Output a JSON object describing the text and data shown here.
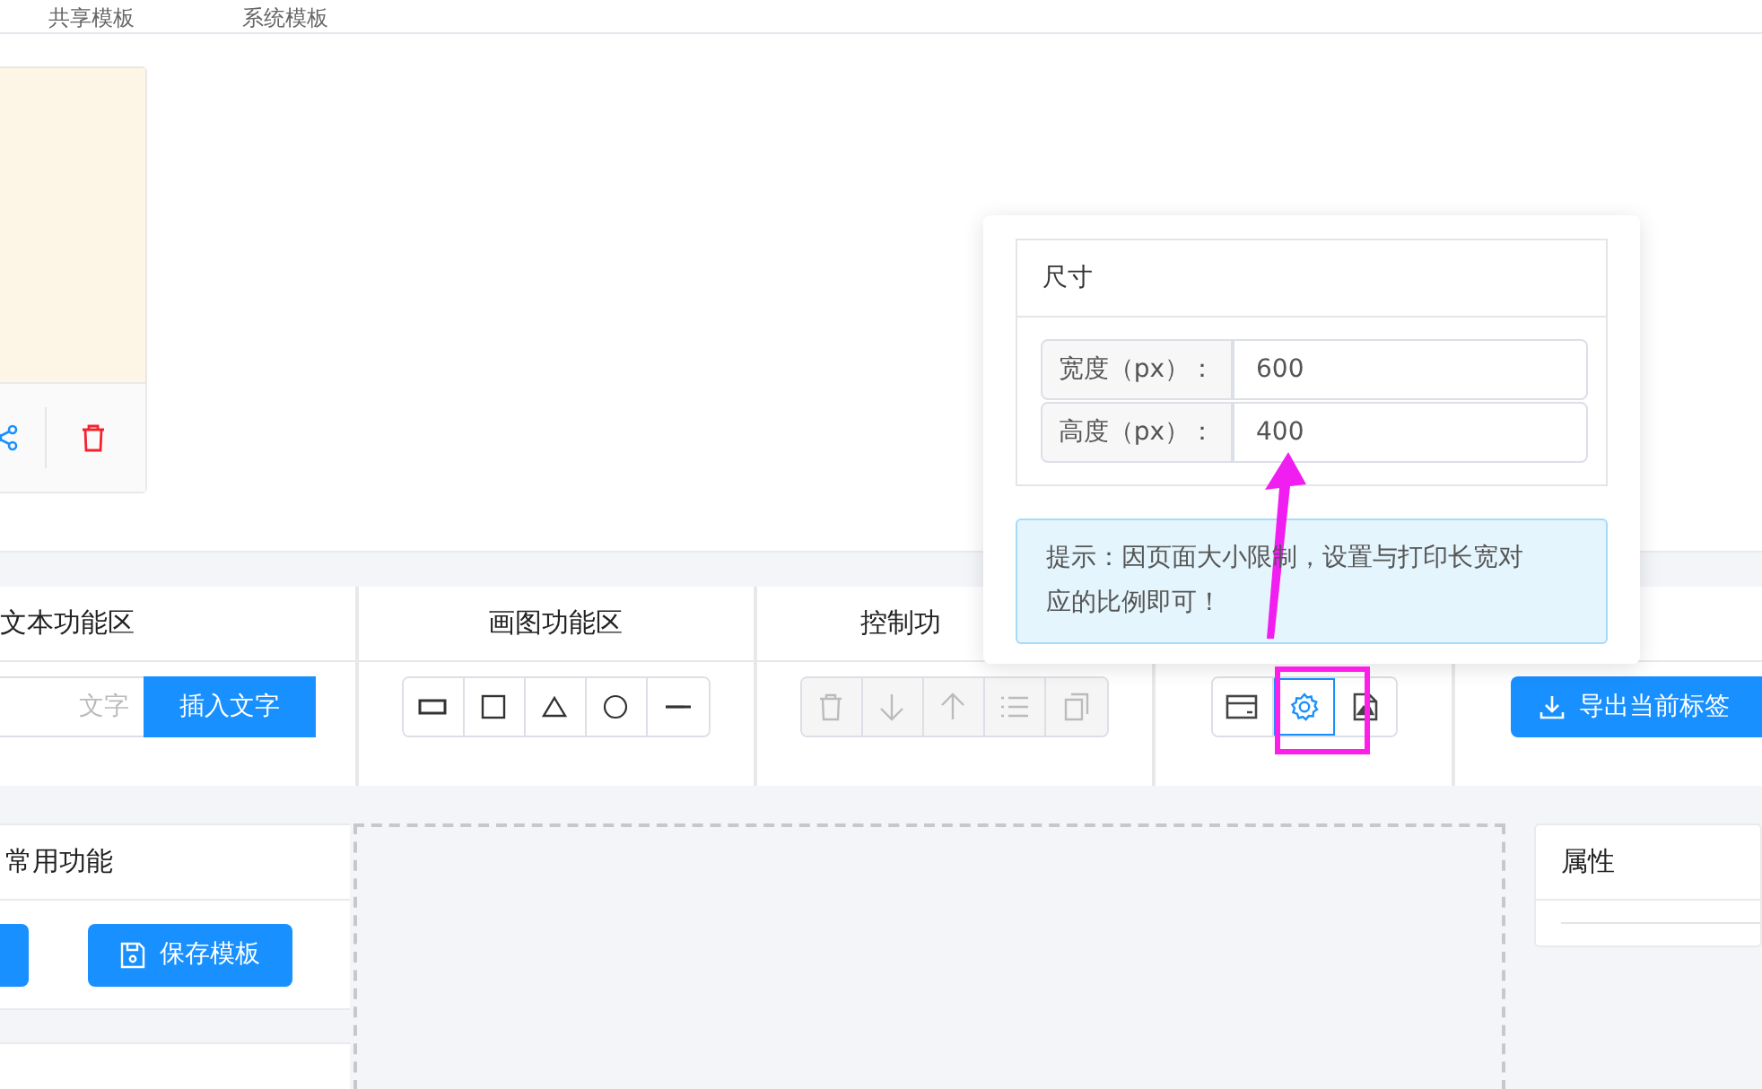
{
  "tabs": [
    {
      "label": "共享模板"
    },
    {
      "label": "系统模板"
    }
  ],
  "toolbar": [
    {
      "kind": "text",
      "title": "文本功能区",
      "placeholder": "文字",
      "button": "插入文字"
    },
    {
      "kind": "shapes",
      "title": "画图功能区"
    },
    {
      "kind": "controls",
      "title": "控制功",
      "disabled": true
    },
    {
      "kind": "settings",
      "tools": [
        {
          "selected": false
        },
        {
          "selected": true
        },
        {
          "selected": false
        }
      ]
    },
    {
      "kind": "export",
      "button": "导出当前标签"
    }
  ],
  "common": {
    "title": "常用功能",
    "button": "保存模板"
  },
  "properties": {
    "title": "属性"
  },
  "popover": {
    "section_title": "尺寸",
    "fields": [
      {
        "label": "宽度（px）：",
        "value": "600"
      },
      {
        "label": "高度（px）：",
        "value": "400"
      }
    ],
    "tip": "提示：因页面大小限制，设置与打印长宽对应的比例即可！"
  }
}
